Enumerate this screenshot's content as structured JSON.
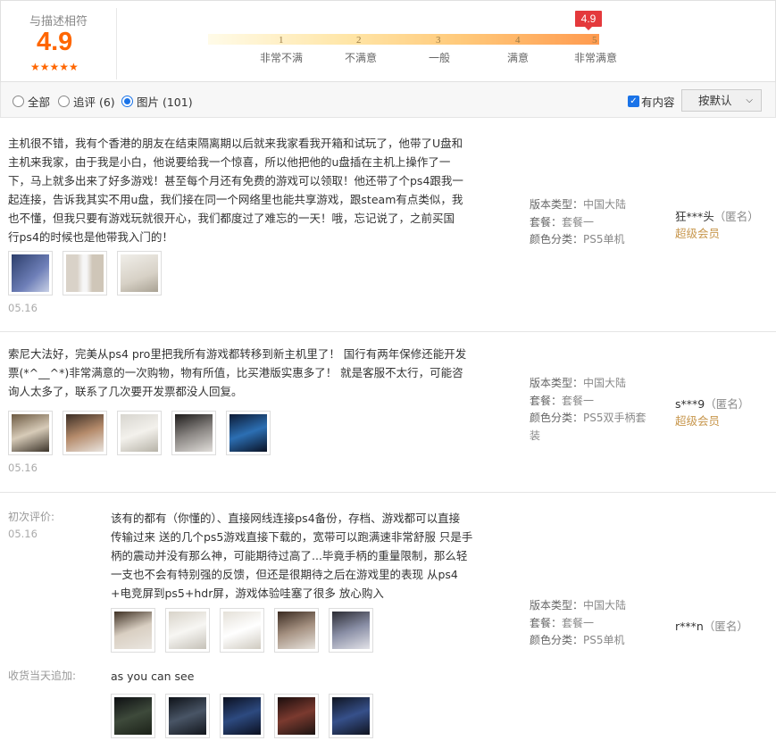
{
  "rating": {
    "label": "与描述相符",
    "score": "4.9",
    "stars": "★★★★★",
    "badge": "4.9",
    "scale": [
      {
        "num": "1",
        "label": "非常不满"
      },
      {
        "num": "2",
        "label": "不满意"
      },
      {
        "num": "3",
        "label": "一般"
      },
      {
        "num": "4",
        "label": "满意"
      },
      {
        "num": "5",
        "label": "非常满意"
      }
    ]
  },
  "filters": {
    "all": "全部",
    "followup": "追评 (6)",
    "images": "图片 (101)",
    "has_content": "有内容",
    "sort_label": "按默认",
    "selected": "images"
  },
  "reviews": [
    {
      "text": "主机很不错，我有个香港的朋友在结束隔离期以后就来我家看我开箱和试玩了，他带了U盘和\n主机来我家，由于我是小白，他说要给我一个惊喜，所以他把他的u盘插在主机上操作了一\n下，马上就多出来了好多游戏！甚至每个月还有免费的游戏可以领取！他还带了个ps4跟我一\n起连接，告诉我其实不用u盘，我们接在同一个网络里也能共享游戏，跟steam有点类似，我\n也不懂，但我只要有游戏玩就很开心，我们都度过了难忘的一天！哦，忘记说了，之前买国\n行ps4的时候也是他带我入门的！",
      "date": "05.16",
      "meta": [
        {
          "k": "版本类型：",
          "v": "中国大陆"
        },
        {
          "k": "套餐：",
          "v": "套餐一"
        },
        {
          "k": "颜色分类：",
          "v": "PS5单机"
        }
      ],
      "user": "狂***头",
      "anon": "（匿名）",
      "vip": "超级会员"
    },
    {
      "text": "索尼大法好，完美从ps4 pro里把我所有游戏都转移到新主机里了！ 国行有两年保修还能开发\n票(*^__^*)非常满意的一次购物，物有所值，比买港版实惠多了！ 就是客服不太行，可能咨\n询人太多了，联系了几次要开发票都没人回复。",
      "date": "05.16",
      "meta": [
        {
          "k": "版本类型：",
          "v": "中国大陆"
        },
        {
          "k": "套餐：",
          "v": "套餐一"
        },
        {
          "k": "颜色分类：",
          "v": "PS5双手柄套"
        },
        {
          "k": "",
          "v": "装"
        }
      ],
      "user": "s***9",
      "anon": "（匿名）",
      "vip": "超级会员"
    },
    {
      "first_label": "初次评价:",
      "date": "05.16",
      "text": "该有的都有（你懂的）、直接网线连接ps4备份，存档、游戏都可以直接\n传输过来 送的几个ps5游戏直接下载的，宽带可以跑满速非常舒服 只是手\n柄的震动并没有那么神，可能期待过高了...毕竟手柄的重量限制，那么轻\n一支也不会有特别强的反馈，但还是很期待之后在游戏里的表现 从ps4\n+电竞屏到ps5+hdr屏，游戏体验哇塞了很多 放心购入",
      "append_label": "收货当天追加:",
      "append_text": "as you can see",
      "meta": [
        {
          "k": "版本类型：",
          "v": "中国大陆"
        },
        {
          "k": "套餐：",
          "v": "套餐一"
        },
        {
          "k": "颜色分类：",
          "v": "PS5单机"
        }
      ],
      "user": "r***n",
      "anon": "（匿名）"
    }
  ]
}
